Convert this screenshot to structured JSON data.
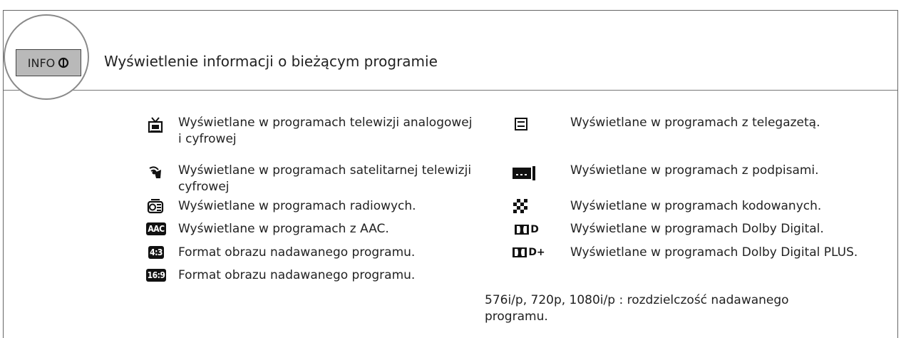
{
  "info_button": {
    "label": "INFO"
  },
  "heading": "Wyświetlenie informacji o bieżącym programie",
  "left_items": [
    {
      "icon": "tv-icon",
      "text": "Wyświetlane w programach telewizji analogowej i cyfrowej"
    },
    {
      "icon": "satellite-icon",
      "text": "Wyświetlane w programach satelitarnej telewizji cyfrowej"
    },
    {
      "icon": "radio-icon",
      "text": "Wyświetlane w programach radiowych."
    },
    {
      "icon": "aac-icon",
      "badge": "AAC",
      "text": "Wyświetlane w programach z AAC."
    },
    {
      "icon": "aspect-4-3-icon",
      "badge": "4:3",
      "text": "Format obrazu nadawanego programu."
    },
    {
      "icon": "aspect-16-9-icon",
      "badge": "16:9",
      "text": "Format obrazu nadawanego programu."
    }
  ],
  "right_items": [
    {
      "icon": "teletext-icon",
      "text": "Wyświetlane w programach z telegazetą."
    },
    {
      "icon": "subtitles-icon",
      "text": "Wyświetlane w programach z podpisami."
    },
    {
      "icon": "scrambled-icon",
      "text": "Wyświetlane w programach kodowanych."
    },
    {
      "icon": "dolby-digital-icon",
      "badge": "D",
      "text": "Wyświetlane w programach Dolby Digital."
    },
    {
      "icon": "dolby-digital-plus-icon",
      "badge": "D+",
      "text": "Wyświetlane w programach Dolby Digital PLUS."
    }
  ],
  "resolution_note": "576i/p, 720p, 1080i/p : rozdzielczość nadawanego programu."
}
